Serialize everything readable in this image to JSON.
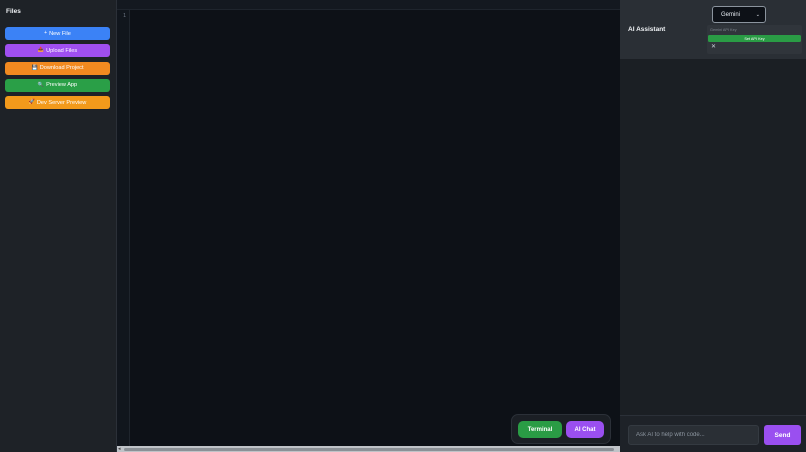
{
  "sidebar": {
    "title": "Files",
    "buttons": [
      {
        "icon": "+",
        "label": "New File",
        "color": "#3b82f6"
      },
      {
        "icon": "📤",
        "label": "Upload Files",
        "color": "#a04ff0"
      },
      {
        "icon": "💾",
        "label": "Download Project",
        "color": "#f28a20"
      },
      {
        "icon": "🔍",
        "label": "Preview App",
        "color": "#2a9f47"
      },
      {
        "icon": "🚀",
        "label": "Dev Server Preview",
        "color": "#f39a1b"
      }
    ]
  },
  "editor": {
    "line_numbers": [
      "1"
    ],
    "scroll_left_arrow": "◂"
  },
  "toggle": {
    "terminal_label": "Terminal",
    "chat_label": "AI Chat"
  },
  "ai_panel": {
    "title": "AI Assistant",
    "provider": {
      "selected": "Gemini",
      "chevron": "⌄"
    },
    "api_key": {
      "placeholder": "Gemini API Key",
      "set_label": "Set API Key",
      "close_glyph": "✕"
    },
    "chat": {
      "input_placeholder": "Ask AI to help with code...",
      "send_label": "Send"
    }
  },
  "colors": {
    "accent_purple": "#9a4ff0",
    "accent_green": "#2a9c45",
    "editor_bg": "#0d1117",
    "panel_bg": "#1b1f24"
  }
}
